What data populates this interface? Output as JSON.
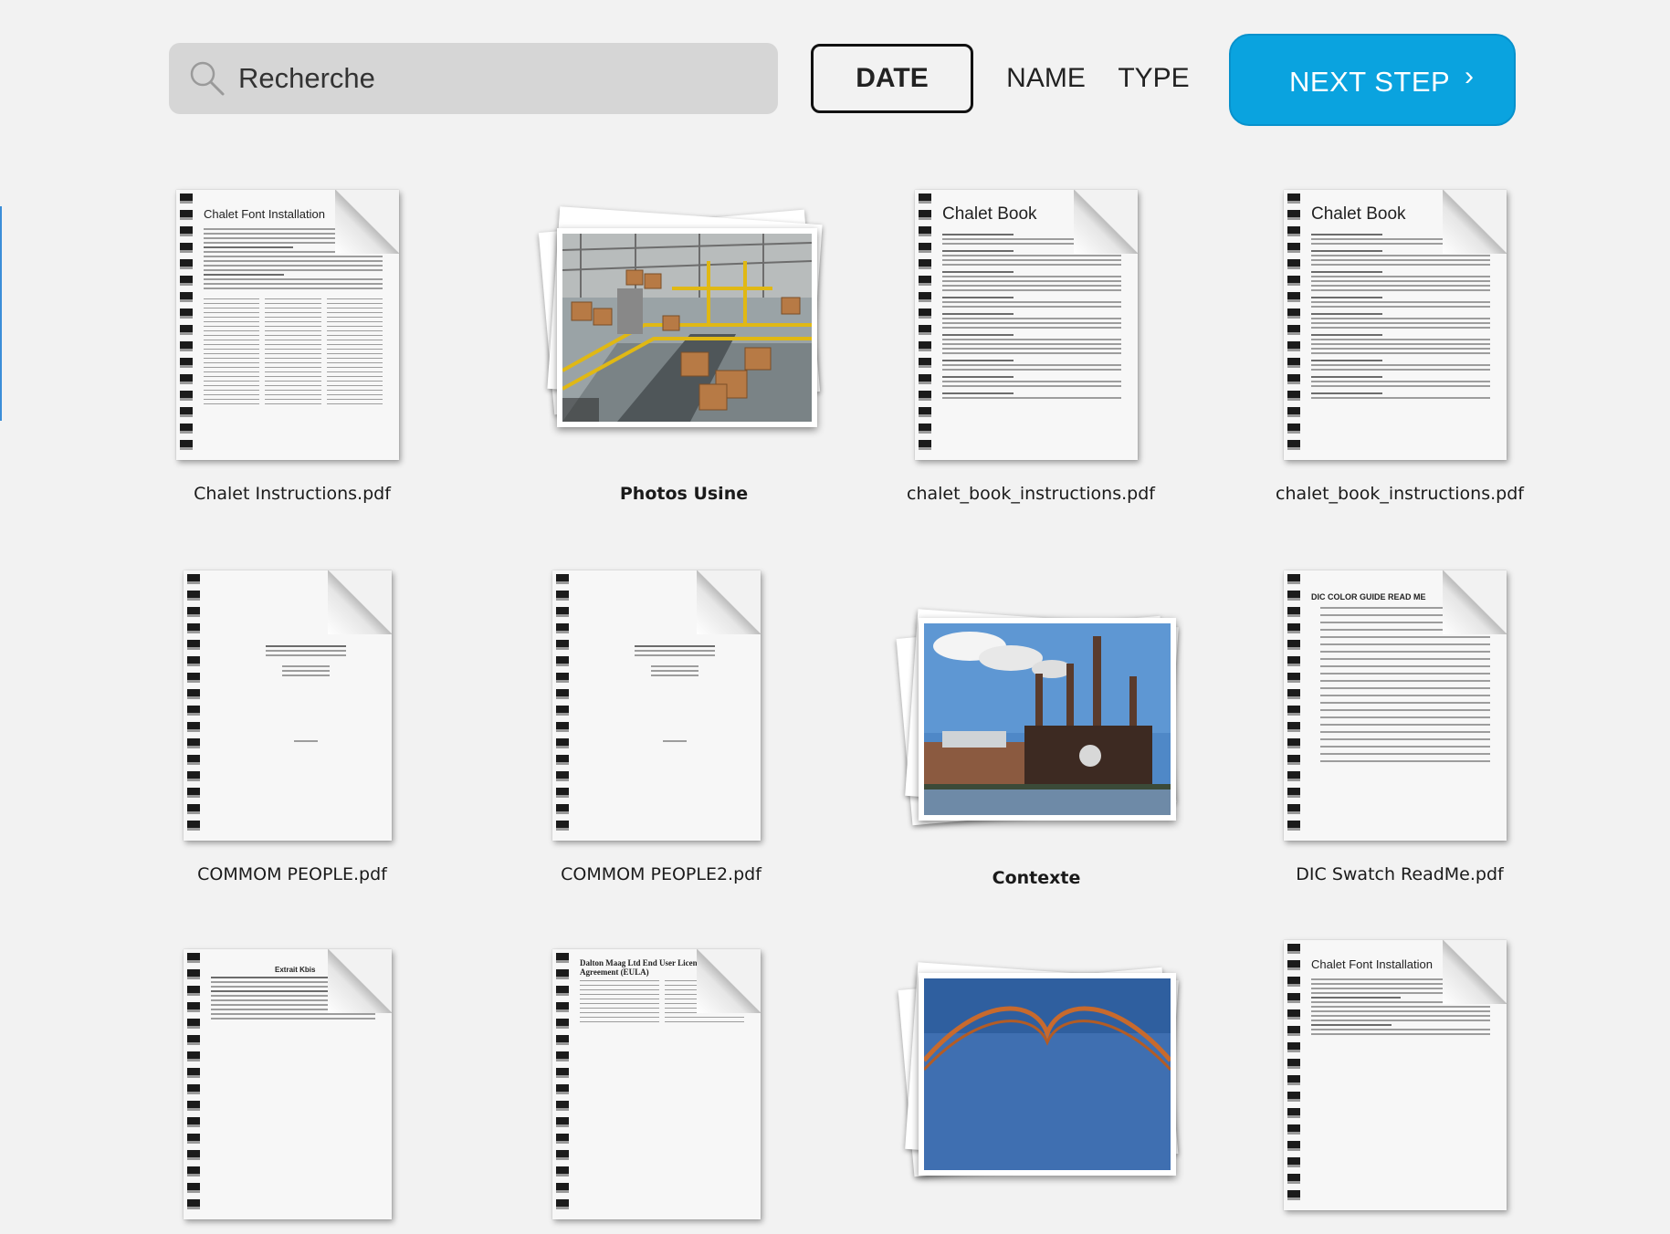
{
  "toolbar": {
    "search_placeholder": "Recherche",
    "sort_options": [
      "DATE",
      "NAME",
      "TYPE"
    ],
    "active_sort": "DATE",
    "next_step_label": "NEXT STEP",
    "next_step_chevron": "›",
    "accent_color": "#0aa3df"
  },
  "items": [
    {
      "name": "Chalet Instructions.pdf",
      "kind": "document",
      "icon": "pdf-document-icon",
      "doc_title": "Chalet Font Installation"
    },
    {
      "name": "Photos Usine",
      "kind": "photo-album",
      "icon": "photo-stack-icon"
    },
    {
      "name": "chalet_book_instructions.pdf",
      "kind": "document",
      "icon": "pdf-document-icon",
      "doc_title": "Chalet Book"
    },
    {
      "name": "chalet_book_instructions.pdf",
      "kind": "document",
      "icon": "pdf-document-icon",
      "doc_title": "Chalet Book"
    },
    {
      "name": "COMMOM PEOPLE.pdf",
      "kind": "document",
      "icon": "pdf-document-icon"
    },
    {
      "name": "COMMOM PEOPLE2.pdf",
      "kind": "document",
      "icon": "pdf-document-icon"
    },
    {
      "name": "Contexte",
      "kind": "photo-album",
      "icon": "photo-stack-icon"
    },
    {
      "name": "DIC Swatch ReadMe.pdf",
      "kind": "document",
      "icon": "pdf-document-icon",
      "doc_title": "DIC COLOR GUIDE READ ME"
    },
    {
      "name": "",
      "kind": "document",
      "icon": "pdf-document-icon",
      "doc_title": "Extrait Kbis"
    },
    {
      "name": "",
      "kind": "document",
      "icon": "pdf-document-icon",
      "doc_title": "Dalton Maag Ltd End User Licence Agreement (EULA)"
    },
    {
      "name": "",
      "kind": "photo-album",
      "icon": "photo-stack-icon"
    },
    {
      "name": "",
      "kind": "document",
      "icon": "pdf-document-icon",
      "doc_title": "Chalet Font Installation"
    }
  ]
}
